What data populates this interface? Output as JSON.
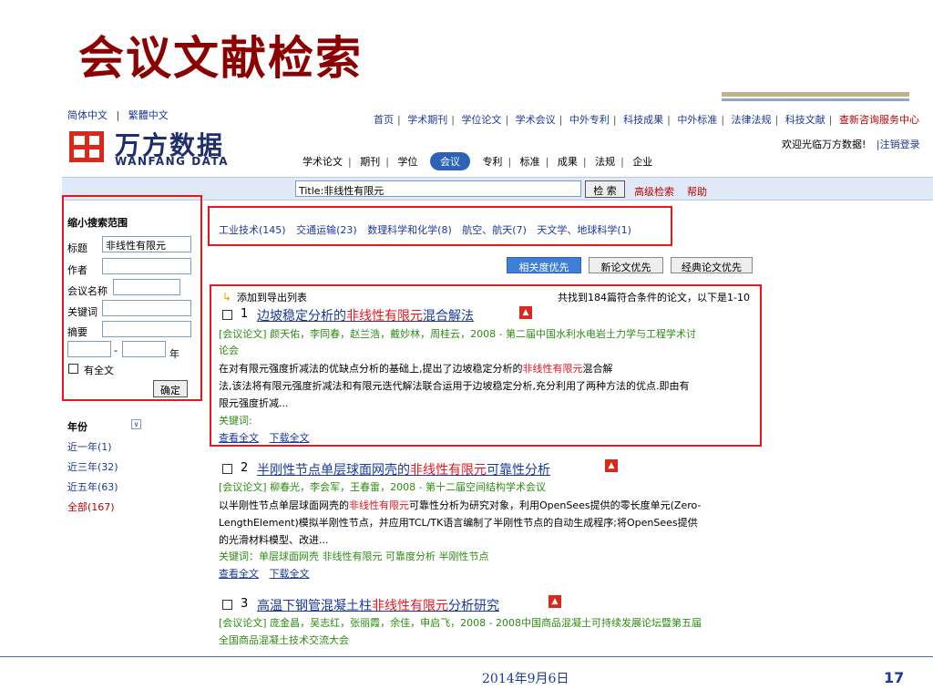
{
  "slide": {
    "title": "会议文献检索",
    "date": "2014年9月6日",
    "page_number": "17"
  },
  "site": {
    "lang_links": [
      "简体中文",
      "繁體中文"
    ],
    "lang_sep": "|",
    "logo_cn": "万方数据",
    "logo_en": "WANFANG DATA",
    "top_nav": [
      "首页",
      "学术期刊",
      "学位论文",
      "学术会议",
      "中外专利",
      "科技成果",
      "中外标准",
      "法律法规",
      "科技文献",
      "查新咨询服务中心"
    ],
    "welcome": "欢迎光临万方数据!",
    "logout": "|注销登录",
    "sub_nav": [
      "学术论文",
      "期刊",
      "学位",
      "会议",
      "专利",
      "标准",
      "成果",
      "法规",
      "企业"
    ],
    "sub_nav_active": "会议",
    "search_value": "Title:非线性有限元",
    "search_button": "检 索",
    "advanced_search": "高级检索",
    "help": "帮助"
  },
  "sidebar": {
    "heading": "缩小搜索范围",
    "fields": [
      {
        "label": "标题",
        "value": "非线性有限元"
      },
      {
        "label": "作者",
        "value": ""
      },
      {
        "label": "会议名称",
        "value": ""
      },
      {
        "label": "关键词",
        "value": ""
      },
      {
        "label": "摘要",
        "value": ""
      }
    ],
    "year_dash": "-",
    "year_suffix": "年",
    "fulltext_label": "有全文",
    "confirm_button": "确定",
    "year_heading": "年份",
    "year_links": [
      "近一年(1)",
      "近三年(32)",
      "近五年(63)",
      "全部(167)"
    ]
  },
  "categories": [
    "工业技术(145)",
    "交通运输(23)",
    "数理科学和化学(8)",
    "航空、航天(7)",
    "天文学、地球科学(1)"
  ],
  "sort_buttons": [
    "相关度优先",
    "新论文优先",
    "经典论文优先"
  ],
  "results_header": {
    "add_export": "添加到导出列表",
    "count": "共找到184篇符合条件的论文，以下是1-10"
  },
  "results": [
    {
      "num": "1",
      "title_pre": "边坡稳定分析的",
      "title_hl": "非线性有限元",
      "title_post": "混合解法",
      "meta_line1": "[会议论文] 颜天佑，李同春，赵兰浩，戴妙林，周桂云，2008 - 第二届中国水利水电岩土力学与工程学术讨",
      "meta_line2": "论会",
      "abstract_pre": "在对有限元强度折减法的优缺点分析的基础上,提出了边坡稳定分析的",
      "abstract_hl": "非线性有限元",
      "abstract_post": "混合解",
      "abstract_line2": "法,该法将有限元强度折减法和有限元迭代解法联合运用于边坡稳定分析,充分利用了两种方法的优点.即由有",
      "abstract_line3": "限元强度折减...",
      "keywords": "关键词:",
      "view": "查看全文",
      "download": "下载全文"
    },
    {
      "num": "2",
      "title_pre": "半刚性节点单层球面网壳的",
      "title_hl": "非线性有限元",
      "title_post": "可靠性分析",
      "meta_line1": "[会议论文] 柳春光，李会军，王春雷，2008 - 第十二届空间结构学术会议",
      "abstract_pre": "以半刚性节点单层球面网壳的",
      "abstract_hl": "非线性有限元",
      "abstract_post": "可靠性分析为研究对象，利用OpenSees提供的零长度单元(Zero-",
      "abstract_line2": "LengthElement)模拟半刚性节点，并应用TCL/TK语言编制了半刚性节点的自动生成程序;将OpenSees提供",
      "abstract_line3": "的光滑材料模型、改进...",
      "keywords": "关键词：单层球面网壳 非线性有限元 可靠度分析 半刚性节点",
      "view": "查看全文",
      "download": "下载全文"
    },
    {
      "num": "3",
      "title_pre": "高温下钢管混凝土柱",
      "title_hl": "非线性有限元",
      "title_post": "分析研究",
      "meta_line1": "[会议论文] 庞金昌，吴志红，张丽霞，余佳，申启飞，2008 - 2008中国商品混凝土可持续发展论坛暨第五届",
      "meta_line2": "全国商品混凝土技术交流大会"
    }
  ]
}
